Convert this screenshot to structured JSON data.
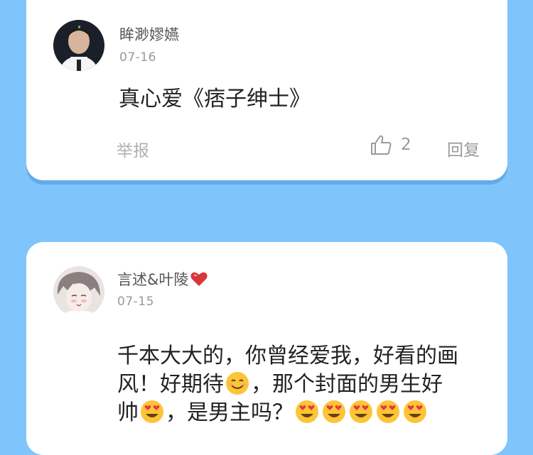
{
  "comments": [
    {
      "username": "眸渺嫪嬿",
      "date": "07-16",
      "text": "真心爱《痞子绅士》",
      "report_label": "举报",
      "like_count": "2",
      "reply_label": "回复"
    },
    {
      "username": "言述&叶陵",
      "date": "07-15",
      "text_line1": "千本大大的，你曾经爱我，好看的画",
      "text_line2a": "风！好期待",
      "text_line2b": "，那个封面的男生好",
      "text_line3a": "帅",
      "text_line3b": "，是男主吗？"
    }
  ],
  "colors": {
    "background": "#7fc5fb",
    "card": "#ffffff",
    "heart": "#d9353d"
  },
  "icons": [
    "thumbs-up-icon",
    "heart-icon",
    "smiling-emoji",
    "heart-eyes-emoji"
  ]
}
